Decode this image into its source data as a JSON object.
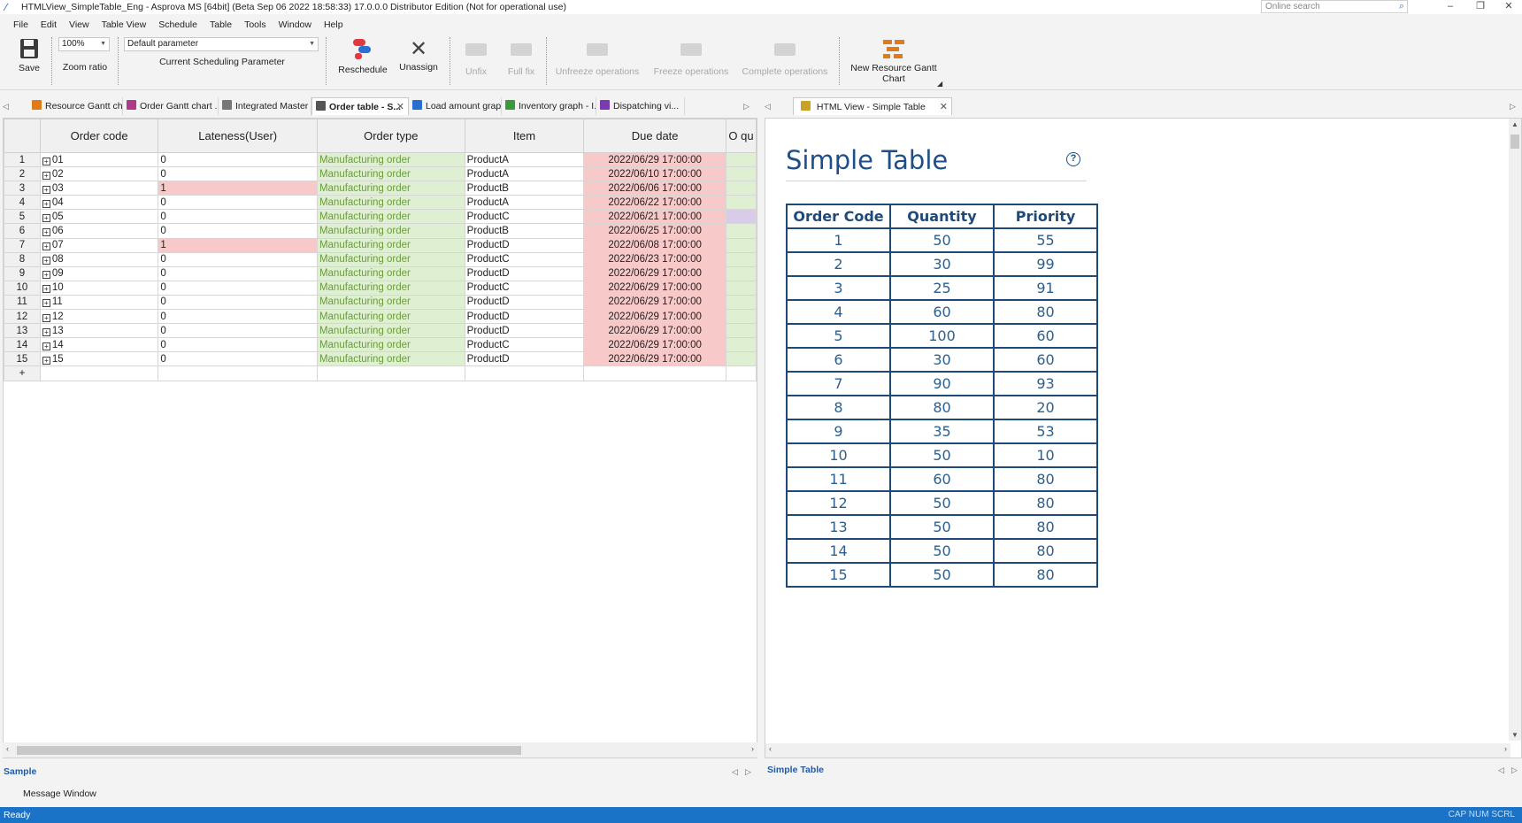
{
  "window": {
    "title": "HTMLView_SimpleTable_Eng - Asprova MS [64bit] (Beta Sep 06 2022 18:58:33) 17.0.0.0 Distributor Edition (Not for operational use)",
    "search_placeholder": "Online search"
  },
  "menu": [
    "File",
    "Edit",
    "View",
    "Table View",
    "Schedule",
    "Table",
    "Tools",
    "Window",
    "Help"
  ],
  "ribbon": {
    "save": "Save",
    "zoom_value": "100%",
    "zoom_label": "Zoom ratio",
    "param_value": "Default parameter",
    "param_label": "Current Scheduling Parameter",
    "reschedule": "Reschedule",
    "unassign": "Unassign",
    "unfix": "Unfix",
    "full_fix": "Full fix",
    "unfreeze": "Unfreeze operations",
    "freeze": "Freeze operations",
    "complete": "Complete operations",
    "new_gantt_line1": "New Resource Gantt",
    "new_gantt_line2": "Chart"
  },
  "tabs_left": [
    {
      "label": "Resource Gantt ch...",
      "icon_color": "#e07b1a"
    },
    {
      "label": "Order Gantt chart ...",
      "icon_color": "#b03a8a"
    },
    {
      "label": "Integrated Master",
      "icon_color": "#777777"
    },
    {
      "label": "Order table - S...",
      "icon_color": "#555555"
    },
    {
      "label": "Load amount grap...",
      "icon_color": "#2a6ed1"
    },
    {
      "label": "Inventory graph - I...",
      "icon_color": "#3a9a3a"
    },
    {
      "label": "Dispatching vi...",
      "icon_color": "#7a3ab0"
    }
  ],
  "tab_right": {
    "label": "HTML View - Simple Table"
  },
  "grid": {
    "columns": [
      "Order code",
      "Lateness(User)",
      "Order type",
      "Item",
      "Due date",
      "O qu"
    ],
    "rows": [
      {
        "n": "1",
        "code": "01",
        "late": "0",
        "type": "Manufacturing order",
        "item": "ProductA",
        "due": "2022/06/29 17:00:00"
      },
      {
        "n": "2",
        "code": "02",
        "late": "0",
        "type": "Manufacturing order",
        "item": "ProductA",
        "due": "2022/06/10 17:00:00"
      },
      {
        "n": "3",
        "code": "03",
        "late": "1",
        "type": "Manufacturing order",
        "item": "ProductB",
        "due": "2022/06/06 17:00:00"
      },
      {
        "n": "4",
        "code": "04",
        "late": "0",
        "type": "Manufacturing order",
        "item": "ProductA",
        "due": "2022/06/22 17:00:00"
      },
      {
        "n": "5",
        "code": "05",
        "late": "0",
        "type": "Manufacturing order",
        "item": "ProductC",
        "due": "2022/06/21 17:00:00"
      },
      {
        "n": "6",
        "code": "06",
        "late": "0",
        "type": "Manufacturing order",
        "item": "ProductB",
        "due": "2022/06/25 17:00:00"
      },
      {
        "n": "7",
        "code": "07",
        "late": "1",
        "type": "Manufacturing order",
        "item": "ProductD",
        "due": "2022/06/08 17:00:00"
      },
      {
        "n": "8",
        "code": "08",
        "late": "0",
        "type": "Manufacturing order",
        "item": "ProductC",
        "due": "2022/06/23 17:00:00"
      },
      {
        "n": "9",
        "code": "09",
        "late": "0",
        "type": "Manufacturing order",
        "item": "ProductD",
        "due": "2022/06/29 17:00:00"
      },
      {
        "n": "10",
        "code": "10",
        "late": "0",
        "type": "Manufacturing order",
        "item": "ProductC",
        "due": "2022/06/29 17:00:00"
      },
      {
        "n": "11",
        "code": "11",
        "late": "0",
        "type": "Manufacturing order",
        "item": "ProductD",
        "due": "2022/06/29 17:00:00"
      },
      {
        "n": "12",
        "code": "12",
        "late": "0",
        "type": "Manufacturing order",
        "item": "ProductD",
        "due": "2022/06/29 17:00:00"
      },
      {
        "n": "13",
        "code": "13",
        "late": "0",
        "type": "Manufacturing order",
        "item": "ProductD",
        "due": "2022/06/29 17:00:00"
      },
      {
        "n": "14",
        "code": "14",
        "late": "0",
        "type": "Manufacturing order",
        "item": "ProductC",
        "due": "2022/06/29 17:00:00"
      },
      {
        "n": "15",
        "code": "15",
        "late": "0",
        "type": "Manufacturing order",
        "item": "ProductD",
        "due": "2022/06/29 17:00:00"
      }
    ],
    "add_row": "+"
  },
  "html_view": {
    "title": "Simple Table",
    "help": "?",
    "headers": [
      "Order Code",
      "Quantity",
      "Priority"
    ],
    "rows": [
      [
        "1",
        "50",
        "55"
      ],
      [
        "2",
        "30",
        "99"
      ],
      [
        "3",
        "25",
        "91"
      ],
      [
        "4",
        "60",
        "80"
      ],
      [
        "5",
        "100",
        "60"
      ],
      [
        "6",
        "30",
        "60"
      ],
      [
        "7",
        "90",
        "93"
      ],
      [
        "8",
        "80",
        "20"
      ],
      [
        "9",
        "35",
        "53"
      ],
      [
        "10",
        "50",
        "10"
      ],
      [
        "11",
        "60",
        "80"
      ],
      [
        "12",
        "50",
        "80"
      ],
      [
        "13",
        "50",
        "80"
      ],
      [
        "14",
        "50",
        "80"
      ],
      [
        "15",
        "50",
        "80"
      ]
    ]
  },
  "bottom": {
    "left_tab": "Sample",
    "right_tab": "Simple Table",
    "message_window": "Message Window"
  },
  "status": {
    "text": "Ready",
    "indicators": "CAP  NUM  SCRL"
  },
  "colors": {
    "order_type_bg": "#dff0d2",
    "due_bg": "#f7c9c9",
    "status_bar": "#1a73c7",
    "html_title": "#1e4f8a"
  }
}
